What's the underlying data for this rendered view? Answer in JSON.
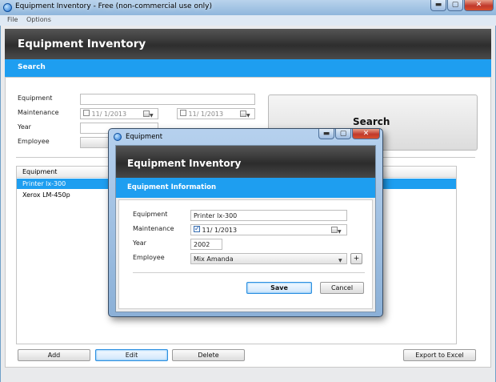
{
  "window": {
    "title": "Equipment Inventory - Free (non-commercial use only)",
    "caption_buttons": {
      "minimize": "▬",
      "maximize": "▢",
      "close": "✕"
    }
  },
  "menu": [
    "File",
    "Options"
  ],
  "header": {
    "title": "Equipment Inventory"
  },
  "search_band": {
    "title": "Search"
  },
  "search_form": {
    "equipment_label": "Equipment",
    "maintenance_label": "Maintenance",
    "year_label": "Year",
    "employee_label": "Employee",
    "date_from": "11/  1/2013",
    "date_to": "11/  1/2013",
    "search_button": "Search"
  },
  "grid": {
    "column_header": "Equipment",
    "rows": [
      "Printer lx-300",
      "Xerox LM-450p"
    ],
    "selected_index": 0
  },
  "buttons": {
    "add": "Add",
    "edit": "Edit",
    "delete": "Delete",
    "export": "Export to Excel"
  },
  "dialog": {
    "title": "Equipment",
    "header": "Equipment Inventory",
    "section": "Equipment Information",
    "equipment_label": "Equipment",
    "equipment_value": "Printer lx-300",
    "maintenance_label": "Maintenance",
    "maintenance_date": "11/  1/2013",
    "maintenance_checked": true,
    "year_label": "Year",
    "year_value": "2002",
    "employee_label": "Employee",
    "employee_value": "Mix Amanda",
    "add_employee": "+",
    "save": "Save",
    "cancel": "Cancel",
    "caption_buttons": {
      "minimize": "▬",
      "maximize": "▢",
      "close": "✕"
    }
  },
  "colors": {
    "accent_blue": "#1e9ef0",
    "header_dark": "#2e2e2e",
    "close_red": "#c0392b"
  },
  "icons": {
    "app": "app-icon",
    "calendar": "calendar-icon",
    "dropdown": "chevron-down-icon"
  }
}
